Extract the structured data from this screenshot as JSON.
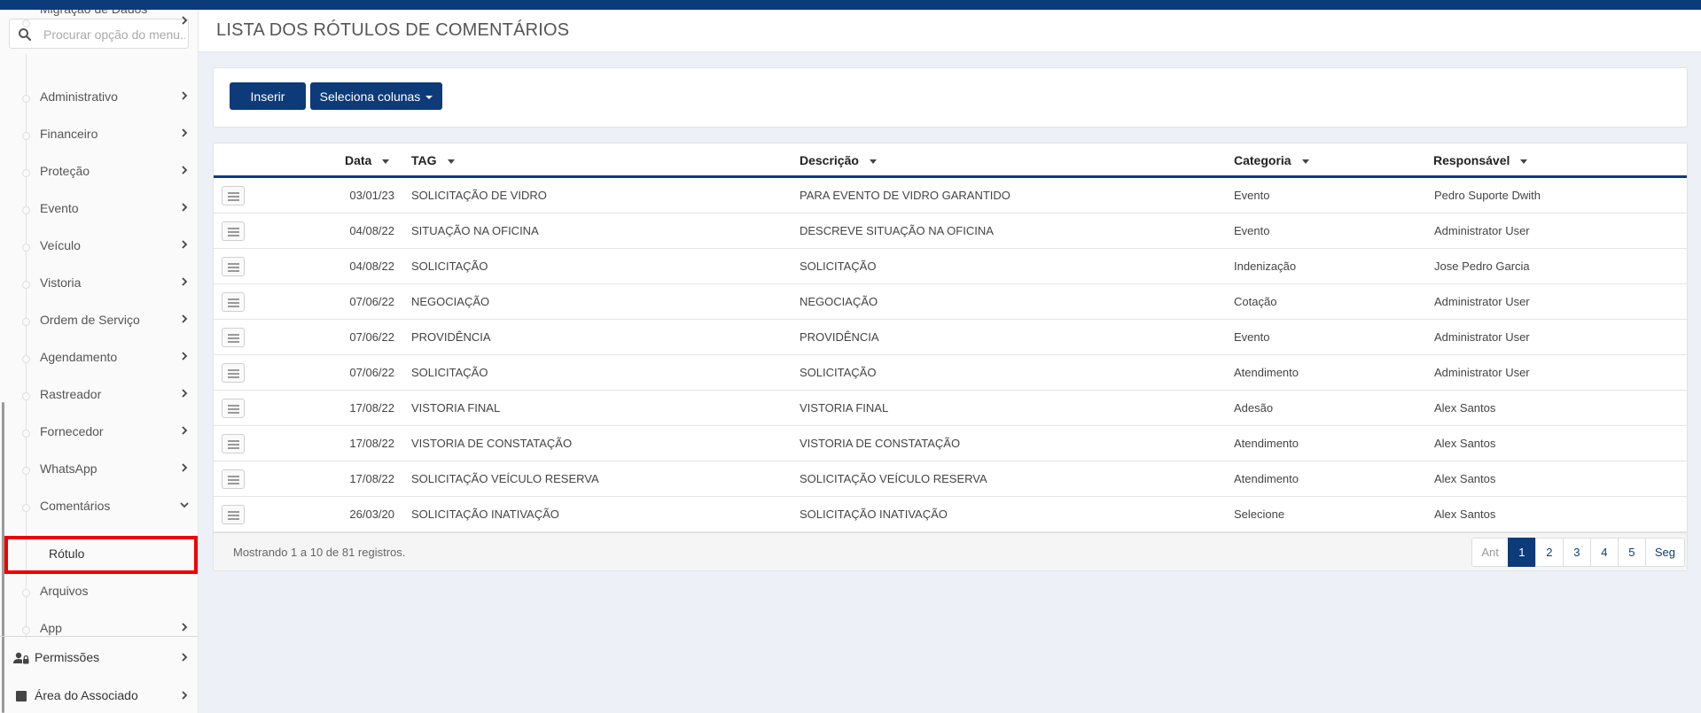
{
  "page": {
    "title": "LISTA DOS RÓTULOS DE COMENTÁRIOS"
  },
  "colors": {
    "brand": "#0d3b7a",
    "highlight": "#ee0000"
  },
  "sidebar": {
    "search": {
      "placeholder": "Procurar opção do menu..."
    },
    "items": [
      {
        "label": "Migração de Dados",
        "chevron": "right"
      },
      {
        "label": "Administrativo",
        "chevron": "right"
      },
      {
        "label": "Financeiro",
        "chevron": "right"
      },
      {
        "label": "Proteção",
        "chevron": "right"
      },
      {
        "label": "Evento",
        "chevron": "right"
      },
      {
        "label": "Veículo",
        "chevron": "right"
      },
      {
        "label": "Vistoria",
        "chevron": "right"
      },
      {
        "label": "Ordem de Serviço",
        "chevron": "right"
      },
      {
        "label": "Agendamento",
        "chevron": "right"
      },
      {
        "label": "Rastreador",
        "chevron": "right"
      },
      {
        "label": "Fornecedor",
        "chevron": "right"
      },
      {
        "label": "WhatsApp",
        "chevron": "right"
      },
      {
        "label": "Comentários",
        "chevron": "down"
      },
      {
        "label": "Rótulo",
        "active": true
      },
      {
        "label": "Arquivos"
      },
      {
        "label": "App",
        "chevron": "right"
      }
    ],
    "bottom": [
      {
        "label": "Permissões",
        "icon": "user-lock-icon"
      },
      {
        "label": "Área do Associado",
        "icon": "square-icon"
      }
    ]
  },
  "toolbar": {
    "insert_label": "Inserir",
    "columns_label": "Seleciona colunas"
  },
  "table": {
    "columns": [
      "Data",
      "TAG",
      "Descrição",
      "Categoria",
      "Responsável"
    ],
    "rows": [
      {
        "data": "03/01/23",
        "tag": "SOLICITAÇÃO DE VIDRO",
        "descricao": "PARA EVENTO DE VIDRO GARANTIDO",
        "categoria": "Evento",
        "responsavel": "Pedro Suporte Dwith"
      },
      {
        "data": "04/08/22",
        "tag": "SITUAÇÃO NA OFICINA",
        "descricao": "DESCREVE SITUAÇÃO NA OFICINA",
        "categoria": "Evento",
        "responsavel": "Administrator User"
      },
      {
        "data": "04/08/22",
        "tag": "SOLICITAÇÃO",
        "descricao": "SOLICITAÇÃO",
        "categoria": "Indenização",
        "responsavel": "Jose Pedro Garcia"
      },
      {
        "data": "07/06/22",
        "tag": "NEGOCIAÇÃO",
        "descricao": "NEGOCIAÇÃO",
        "categoria": "Cotação",
        "responsavel": "Administrator User"
      },
      {
        "data": "07/06/22",
        "tag": "PROVIDÊNCIA",
        "descricao": "PROVIDÊNCIA",
        "categoria": "Evento",
        "responsavel": "Administrator User"
      },
      {
        "data": "07/06/22",
        "tag": "SOLICITAÇÃO",
        "descricao": "SOLICITAÇÃO",
        "categoria": "Atendimento",
        "responsavel": "Administrator User"
      },
      {
        "data": "17/08/22",
        "tag": "VISTORIA FINAL",
        "descricao": "VISTORIA FINAL",
        "categoria": "Adesão",
        "responsavel": "Alex Santos"
      },
      {
        "data": "17/08/22",
        "tag": "VISTORIA DE CONSTATAÇÃO",
        "descricao": "VISTORIA DE CONSTATAÇÃO",
        "categoria": "Atendimento",
        "responsavel": "Alex Santos"
      },
      {
        "data": "17/08/22",
        "tag": "SOLICITAÇÃO VEÍCULO RESERVA",
        "descricao": "SOLICITAÇÃO VEÍCULO RESERVA",
        "categoria": "Atendimento",
        "responsavel": "Alex Santos"
      },
      {
        "data": "26/03/20",
        "tag": "SOLICITAÇÃO INATIVAÇÃO",
        "descricao": "SOLICITAÇÃO INATIVAÇÃO",
        "categoria": "Selecione",
        "responsavel": "Alex Santos"
      }
    ],
    "footer_text": "Mostrando 1 a 10 de 81 registros."
  },
  "pagination": {
    "prev": "Ant",
    "pages": [
      "1",
      "2",
      "3",
      "4",
      "5"
    ],
    "current": "1",
    "next": "Seg"
  }
}
